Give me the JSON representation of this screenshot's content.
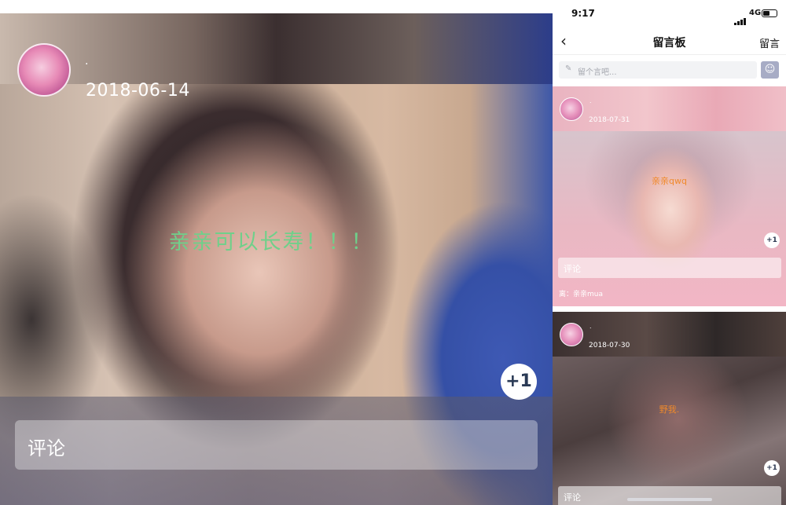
{
  "left": {
    "username": ".",
    "date": "2018-06-14",
    "message": "亲亲可以长寿！！！",
    "plus_label": "+1",
    "comment_placeholder": "评论"
  },
  "phone": {
    "status": {
      "time": "9:17",
      "network": "4G"
    },
    "nav": {
      "back_icon": "chevron-left-icon",
      "title": "留言板",
      "action": "留言"
    },
    "input": {
      "placeholder": "留个言吧...",
      "pen_icon": "pencil-icon",
      "emoji_icon": "face-icon"
    },
    "cards": [
      {
        "username": ".",
        "date": "2018-07-31",
        "message": "亲亲qwq",
        "plus_label": "+1",
        "comment_label": "评论",
        "reply": "离：亲亲mua"
      },
      {
        "username": ".",
        "date": "2018-07-30",
        "message": "野我.",
        "plus_label": "+1",
        "comment_label": "评论"
      }
    ]
  },
  "colors": {
    "message_green": "#6fd08a",
    "message_orange": "#f08a2b",
    "emoji_button": "#a7acc5"
  }
}
